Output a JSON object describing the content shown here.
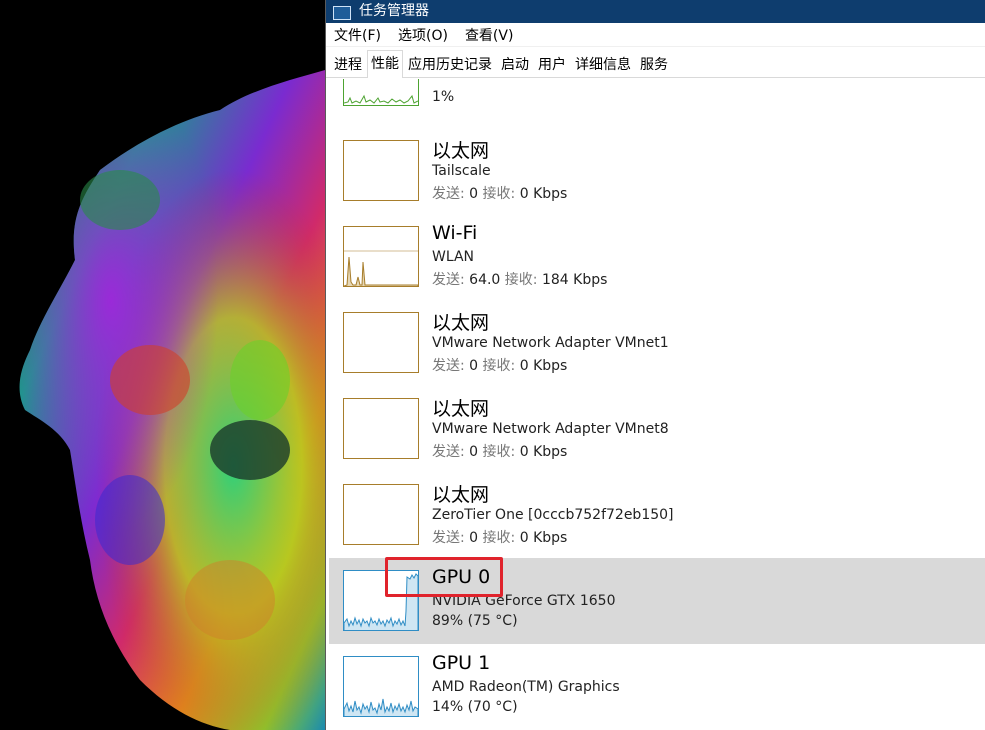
{
  "window": {
    "title": "任务管理器"
  },
  "menu": [
    {
      "label": "文件(F)"
    },
    {
      "label": "选项(O)"
    },
    {
      "label": "查看(V)"
    }
  ],
  "tabs": [
    {
      "label": "进程",
      "active": false
    },
    {
      "label": "性能",
      "active": true
    },
    {
      "label": "应用历史记录",
      "active": false
    },
    {
      "label": "启动",
      "active": false
    },
    {
      "label": "用户",
      "active": false
    },
    {
      "label": "详细信息",
      "active": false
    },
    {
      "label": "服务",
      "active": false
    }
  ],
  "items": {
    "top_partial": {
      "stats": "1%"
    },
    "ethernet_tailscale": {
      "name": "以太网",
      "subtitle": "Tailscale",
      "send_label": "发送:",
      "send_value": "0",
      "recv_label": "接收:",
      "recv_value": "0 Kbps"
    },
    "wifi": {
      "name": "Wi-Fi",
      "subtitle": "WLAN",
      "send_label": "发送:",
      "send_value": "64.0",
      "recv_label": "接收:",
      "recv_value": "184 Kbps"
    },
    "ethernet_vmnet1": {
      "name": "以太网",
      "subtitle": "VMware Network Adapter VMnet1",
      "send_label": "发送:",
      "send_value": "0",
      "recv_label": "接收:",
      "recv_value": "0 Kbps"
    },
    "ethernet_vmnet8": {
      "name": "以太网",
      "subtitle": "VMware Network Adapter VMnet8",
      "send_label": "发送:",
      "send_value": "0",
      "recv_label": "接收:",
      "recv_value": "0 Kbps"
    },
    "ethernet_zerotier": {
      "name": "以太网",
      "subtitle": "ZeroTier One [0cccb752f72eb150]",
      "send_label": "发送:",
      "send_value": "0",
      "recv_label": "接收:",
      "recv_value": "0 Kbps"
    },
    "gpu0": {
      "name": "GPU 0",
      "subtitle": "NVIDIA GeForce GTX 1650",
      "stats": "89% (75 °C)"
    },
    "gpu1": {
      "name": "GPU 1",
      "subtitle": "AMD Radeon(TM) Graphics",
      "stats": "14% (70 °C)"
    }
  },
  "colors": {
    "titlebar": "#0e3d6e",
    "cpu_graph": "#4da331",
    "network_graph": "#a77d2b",
    "gpu_graph": "#2f8dc5",
    "selected_row": "#d9d9d9",
    "highlight_box": "#e0232c"
  }
}
